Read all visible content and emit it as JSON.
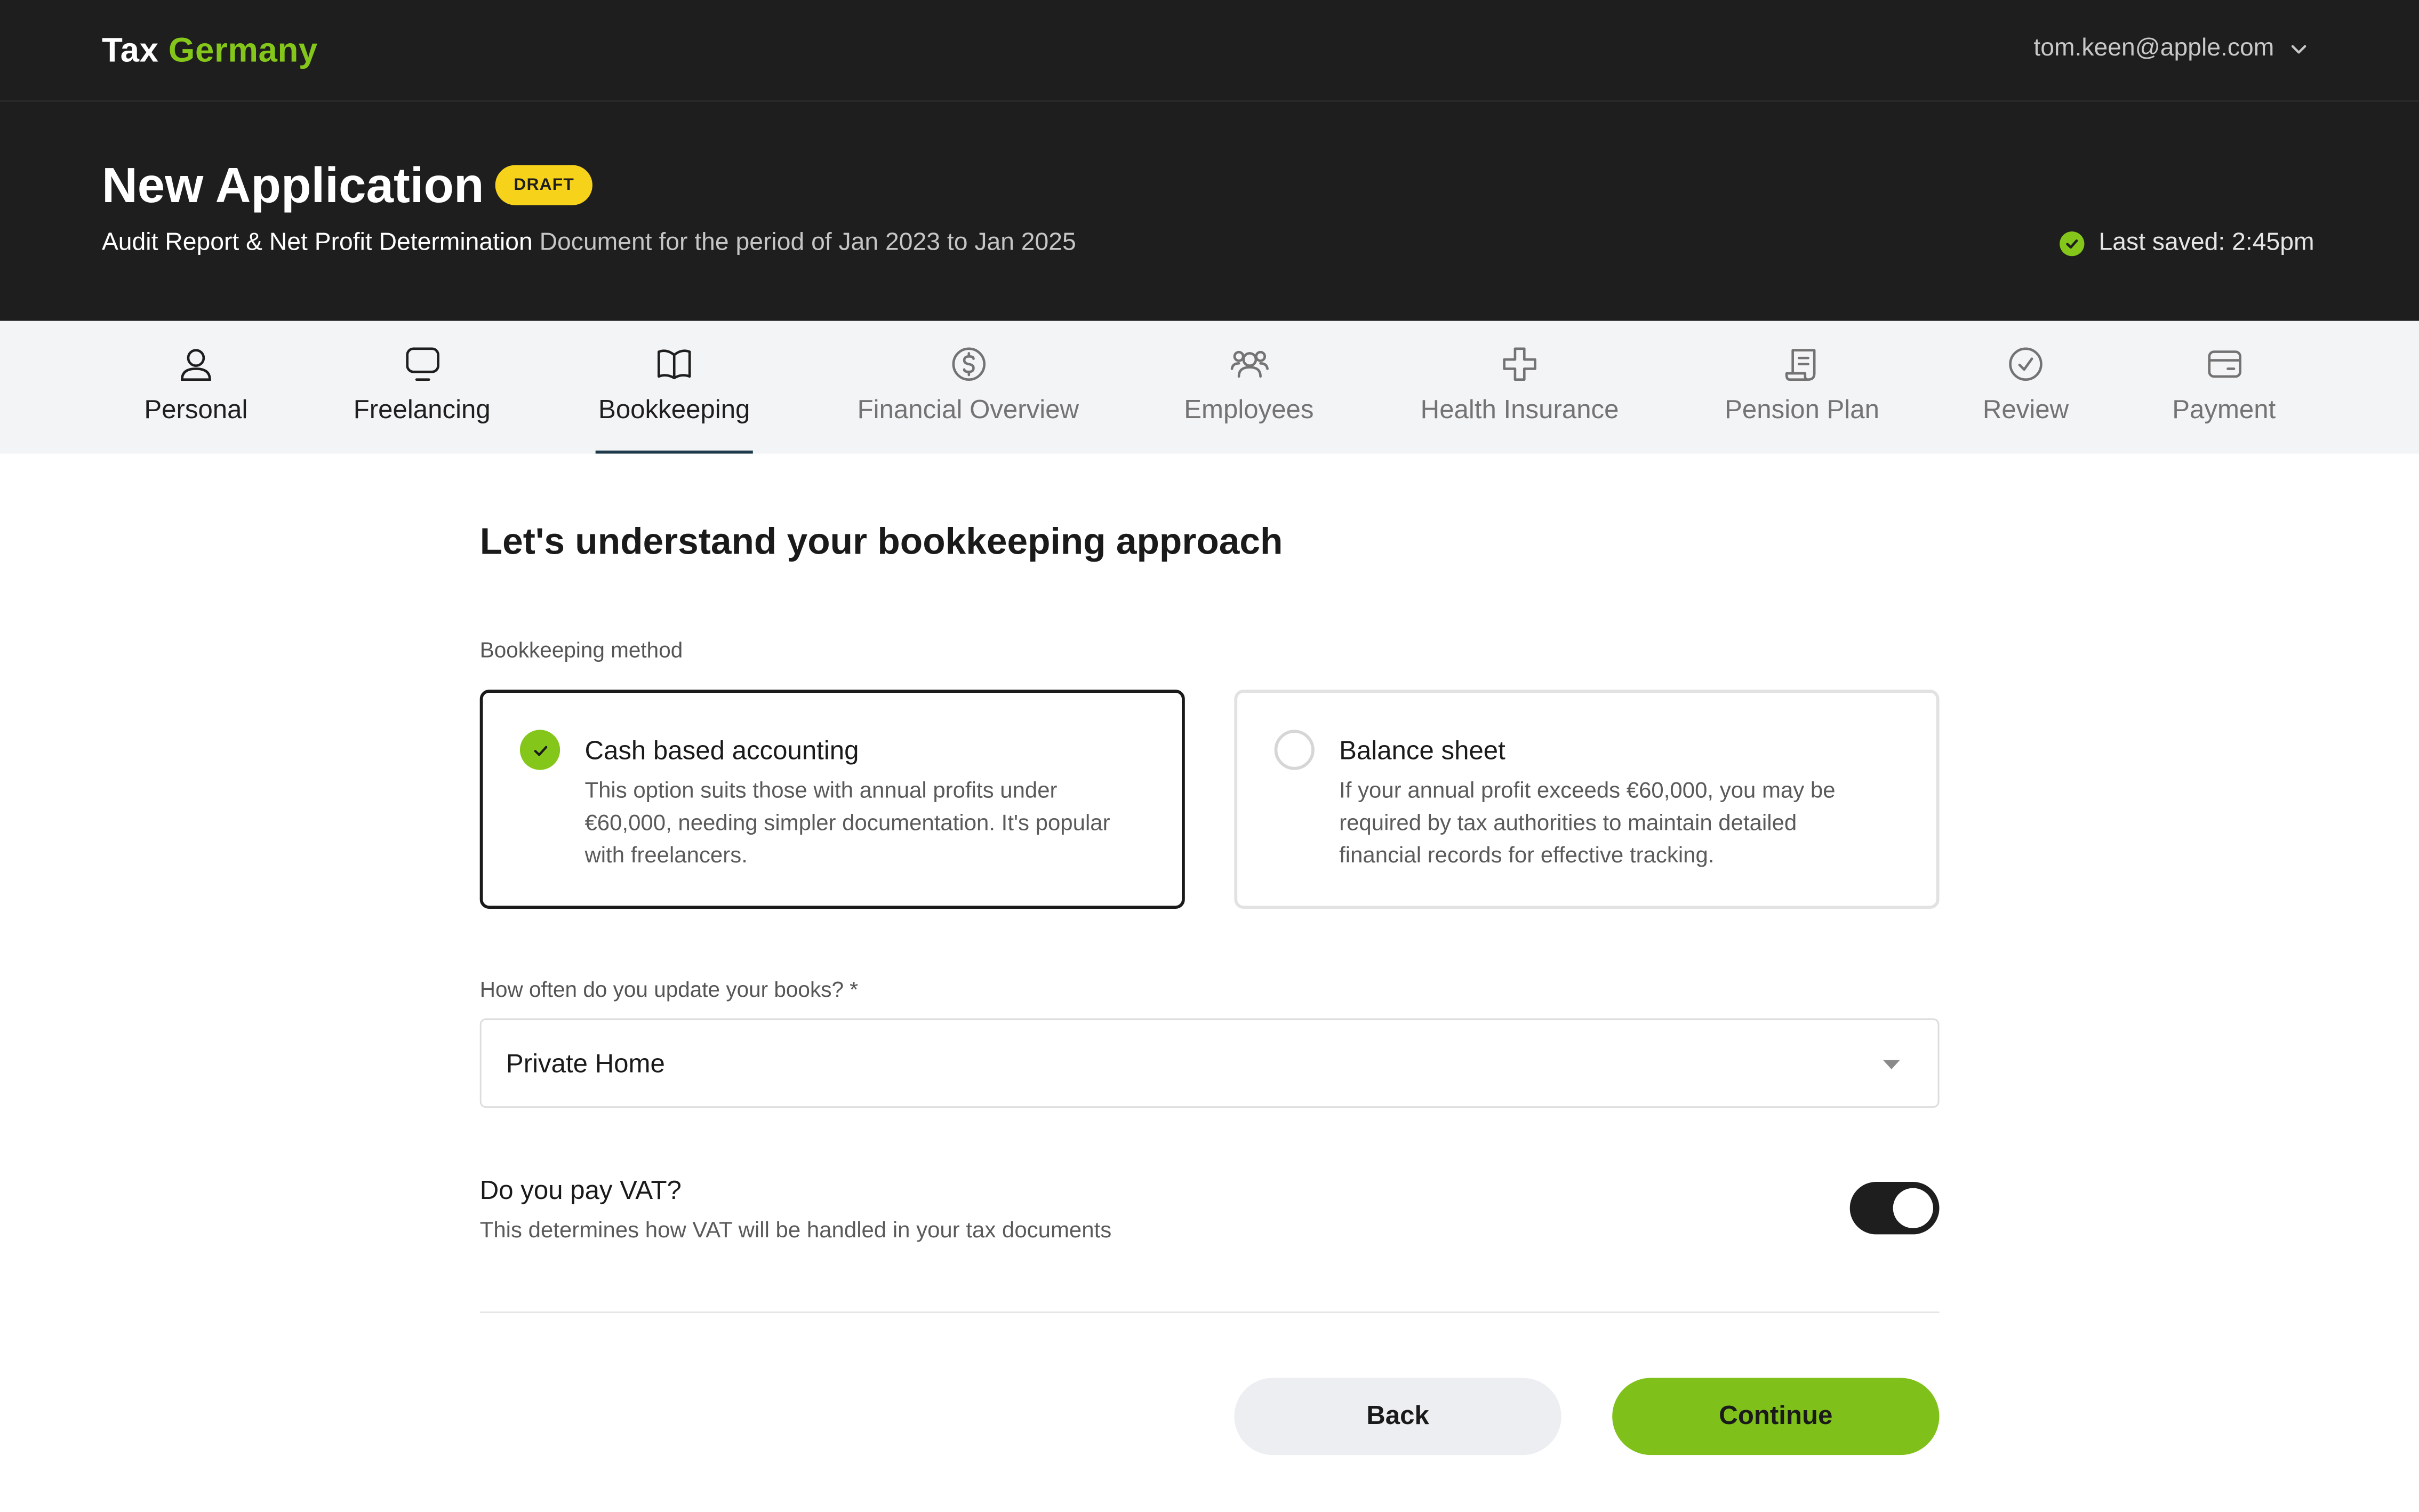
{
  "brand": {
    "word1": "Tax",
    "word2": "Germany",
    "accent": "#84c71a"
  },
  "user": {
    "email": "tom.keen@apple.com",
    "icon": "chevron-down-icon"
  },
  "header": {
    "title": "New Application",
    "badge": "DRAFT",
    "subtitle_part1": "Audit Report",
    "subtitle_amp": " & ",
    "subtitle_part2": "Net Profit Determination",
    "subtitle_rest": " Document for the period of Jan 2023 to Jan 2025",
    "saved_status": "Last saved: 2:45pm"
  },
  "steps": [
    {
      "label": "Personal",
      "icon": "user-icon",
      "state": "done"
    },
    {
      "label": "Freelancing",
      "icon": "monitor-icon",
      "state": "done"
    },
    {
      "label": "Bookkeeping",
      "icon": "book-open-icon",
      "state": "active"
    },
    {
      "label": "Financial Overview",
      "icon": "dollar-circle-icon",
      "state": "todo"
    },
    {
      "label": "Employees",
      "icon": "users-icon",
      "state": "todo"
    },
    {
      "label": "Health Insurance",
      "icon": "medical-cross-icon",
      "state": "todo"
    },
    {
      "label": "Pension Plan",
      "icon": "receipt-icon",
      "state": "todo"
    },
    {
      "label": "Review",
      "icon": "check-circle-icon",
      "state": "todo"
    },
    {
      "label": "Payment",
      "icon": "card-icon",
      "state": "todo"
    }
  ],
  "main": {
    "heading": "Let's understand your bookkeeping approach",
    "method_label": "Bookkeeping method",
    "options": [
      {
        "title": "Cash based accounting",
        "desc": "This option suits those with annual profits under €60,000, needing simpler documentation. It's popular with freelancers.",
        "selected": true
      },
      {
        "title": "Balance sheet",
        "desc": "If your annual profit exceeds €60,000, you may be required by tax authorities to maintain detailed financial records for effective tracking.",
        "selected": false
      }
    ],
    "frequency_label": "How often do you update your books? *",
    "frequency_value": "Private Home",
    "vat_question": "Do you pay VAT?",
    "vat_help": "This determines how VAT will be handled in your tax documents",
    "vat_enabled": true,
    "back_label": "Back",
    "continue_label": "Continue"
  }
}
